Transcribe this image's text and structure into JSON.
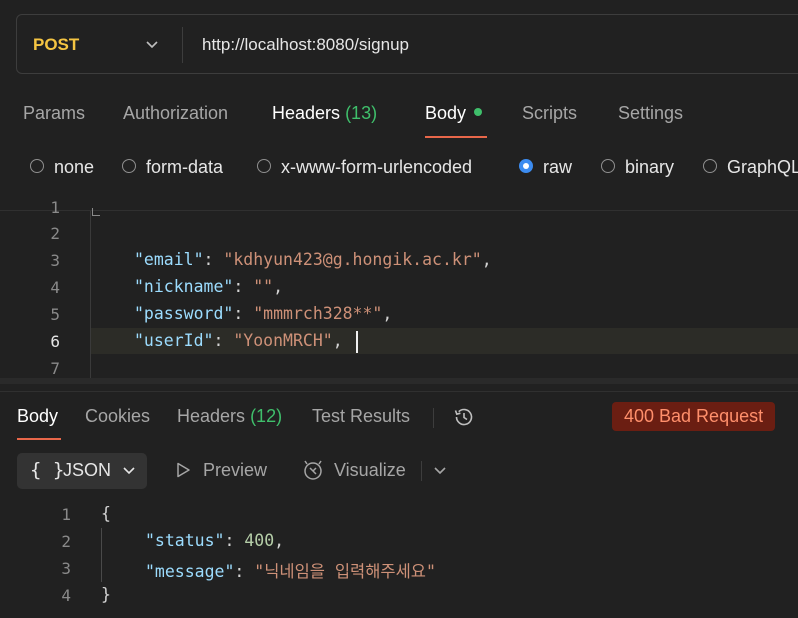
{
  "request": {
    "method": "POST",
    "url": "http://localhost:8080/signup"
  },
  "tabs": [
    {
      "label": "Params"
    },
    {
      "label": "Authorization"
    },
    {
      "label": "Headers",
      "count": "(13)"
    },
    {
      "label": "Body"
    },
    {
      "label": "Scripts"
    },
    {
      "label": "Settings"
    }
  ],
  "body_types": [
    {
      "label": "none",
      "selected": false
    },
    {
      "label": "form-data",
      "selected": false
    },
    {
      "label": "x-www-form-urlencoded",
      "selected": false
    },
    {
      "label": "raw",
      "selected": true
    },
    {
      "label": "binary",
      "selected": false
    },
    {
      "label": "GraphQL",
      "selected": false
    }
  ],
  "editor": {
    "line_numbers": [
      "1",
      "2",
      "3",
      "4",
      "5",
      "6",
      "7"
    ],
    "lines": [
      {
        "key": "\"email\"",
        "value": "\"kdhyun423@g.hongik.ac.kr\""
      },
      {
        "key": "\"nickname\"",
        "value": "\"\""
      },
      {
        "key": "\"password\"",
        "value": "\"mmmrch328**\""
      },
      {
        "key": "\"userId\"",
        "value": "\"YoonMRCH\""
      }
    ],
    "colon": ": ",
    "comma": ","
  },
  "response": {
    "tabs": [
      {
        "label": "Body"
      },
      {
        "label": "Cookies"
      },
      {
        "label": "Headers",
        "count": "(12)"
      },
      {
        "label": "Test Results"
      }
    ],
    "status": "400 Bad Request",
    "format": "JSON",
    "format_icon": "{ }",
    "preview_label": "Preview",
    "visualize_label": "Visualize",
    "line_numbers": [
      "1",
      "2",
      "3",
      "4"
    ],
    "open_brace": "{",
    "close_brace": "}",
    "fields": [
      {
        "key": "\"status\"",
        "value": "400",
        "trail": ","
      },
      {
        "key": "\"message\"",
        "value": "\"닉네임을 입력해주세요\"",
        "trail": ""
      }
    ]
  },
  "colors": {
    "method": "#f5c542",
    "active_tab_underline": "#e8674a",
    "count_green": "#3fbf6b",
    "radio_selected": "#3c8cf0",
    "status_bg": "#6b1e12",
    "status_text": "#ff8f6b"
  }
}
